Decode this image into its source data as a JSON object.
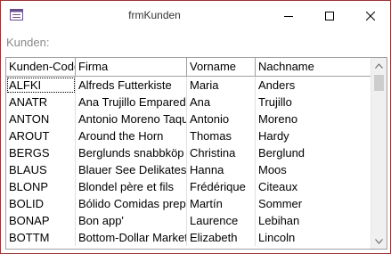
{
  "window": {
    "title": "frmKunden"
  },
  "form": {
    "label": "Kunden:"
  },
  "grid": {
    "columns": [
      "Kunden-Code",
      "Firma",
      "Vorname",
      "Nachname"
    ],
    "rows": [
      [
        "ALFKI",
        "Alfreds Futterkiste",
        "Maria",
        "Anders"
      ],
      [
        "ANATR",
        "Ana Trujillo Emparedados",
        "Ana",
        "Trujillo"
      ],
      [
        "ANTON",
        "Antonio Moreno Taquería",
        "Antonio",
        "Moreno"
      ],
      [
        "AROUT",
        "Around the Horn",
        "Thomas",
        "Hardy"
      ],
      [
        "BERGS",
        "Berglunds snabbköp",
        "Christina",
        "Berglund"
      ],
      [
        "BLAUS",
        "Blauer See Delikatessen",
        "Hanna",
        "Moos"
      ],
      [
        "BLONP",
        "Blondel père et fils",
        "Frédérique",
        "Citeaux"
      ],
      [
        "BOLID",
        "Bólido Comidas preparadas",
        "Martín",
        "Sommer"
      ],
      [
        "BONAP",
        "Bon app'",
        "Laurence",
        "Lebihan"
      ],
      [
        "BOTTM",
        "Bottom-Dollar Markets",
        "Elizabeth",
        "Lincoln"
      ]
    ],
    "selected_row": 0
  }
}
